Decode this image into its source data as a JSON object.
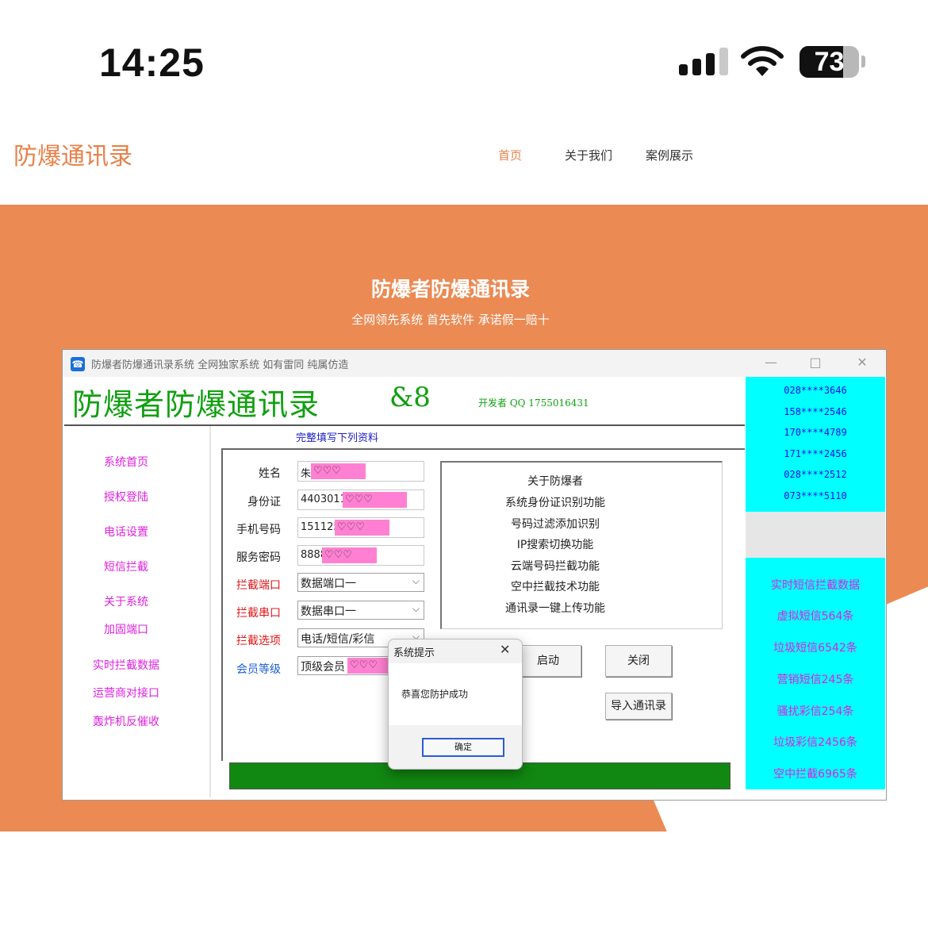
{
  "status_bar": {
    "time": "14:25",
    "battery": "73",
    "battery_level": 0.73
  },
  "site": {
    "logo": "防爆通讯录",
    "nav": [
      "首页",
      "关于我们",
      "案例展示"
    ],
    "active_nav": "首页"
  },
  "hero": {
    "title": "防爆者防爆通讯录",
    "subtitle": "全网领先系统 首先软件 承诺假一赔十"
  },
  "app": {
    "window_title": "防爆者防爆通讯录系统 全网独家系统 如有雷同 纯属仿造",
    "window_controls": [
      "—",
      "□",
      "✕"
    ],
    "big_title": "防爆者防爆通讯录",
    "big_suffix": "&8",
    "developer": "开发者 QQ 1755016431",
    "sidebar": [
      "系统首页",
      "授权登陆",
      "电话设置",
      "短信拦截",
      "关于系统",
      "加固端口",
      "实时拦截数据",
      "运营商对接口",
      "轰炸机反催收"
    ],
    "form_heading": "完整填写下列资料",
    "fields": [
      {
        "label": "姓名",
        "value": "朱",
        "mask": "♡♡♡"
      },
      {
        "label": "身份证",
        "value": "4403011",
        "mask": "♡♡♡"
      },
      {
        "label": "手机号码",
        "value": "151125",
        "mask": "♡♡♡"
      },
      {
        "label": "服务密码",
        "value": "8888",
        "mask": "♡♡♡"
      }
    ],
    "selects": [
      {
        "label": "拦截端口",
        "value": "数据端口一"
      },
      {
        "label": "拦截串口",
        "value": "数据串口一"
      },
      {
        "label": "拦截选项",
        "value": "电话/短信/彩信"
      },
      {
        "label": "会员等级",
        "value": "顶级会员",
        "mask": "♡♡♡"
      }
    ],
    "features": [
      "关于防爆者",
      "系统身份证识别功能",
      "号码过滤添加识别",
      "IP搜索切换功能",
      "云端号码拦截功能",
      "空中拦截技术功能",
      "通讯录一键上传功能"
    ],
    "buttons": {
      "start": "启动",
      "close": "关闭",
      "import": "导入通讯录"
    },
    "phone_list": [
      "028****3646",
      "158****2546",
      "170****4789",
      "171****2456",
      "028****2512",
      "073****5110"
    ],
    "stats": [
      "实时短信拦截数据",
      "虚拟短信564条",
      "垃圾短信6542条",
      "营销短信245条",
      "骚扰彩信254条",
      "垃圾彩信2456条",
      "空中拦截6965条"
    ],
    "dialog": {
      "title": "系统提示",
      "close": "✕",
      "message": "恭喜您防护成功",
      "ok": "确定"
    }
  },
  "colors": {
    "brand_orange": "#eb8a53",
    "accent_green": "#10a010",
    "cyan_panel": "#00ffff",
    "magenta_text": "#e020e0"
  }
}
